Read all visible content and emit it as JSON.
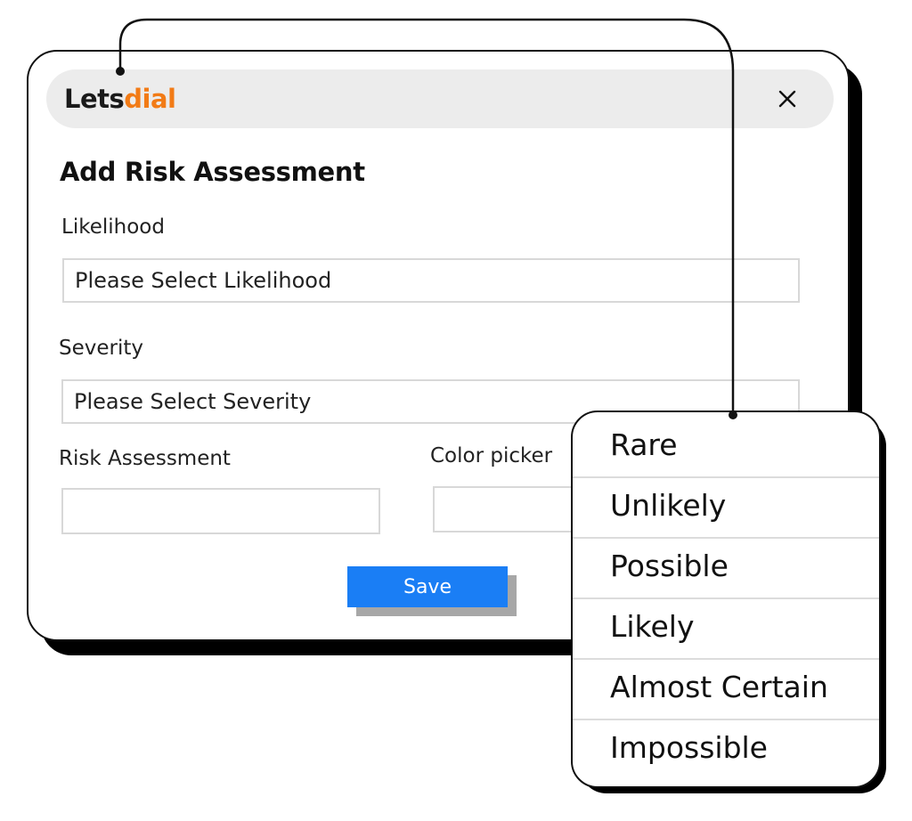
{
  "logo": {
    "part1": "Lets",
    "part2": "dial"
  },
  "dialog": {
    "title": "Add Risk Assessment",
    "close_icon": "close-icon"
  },
  "form": {
    "likelihood_label": "Likelihood",
    "likelihood_placeholder": "Please Select Likelihood",
    "severity_label": "Severity",
    "severity_placeholder": "Please Select Severity",
    "risk_assessment_label": "Risk Assessment",
    "risk_assessment_value": "",
    "color_picker_label": "Color picker",
    "color_picker_value": "",
    "save_label": "Save"
  },
  "dropdown": {
    "options": [
      "Rare",
      "Unlikely",
      "Possible",
      "Likely",
      "Almost Certain",
      "Impossible"
    ]
  },
  "colors": {
    "accent": "#1a7ef5",
    "brand_orange": "#f27b16",
    "header_bg": "#ececec",
    "border": "#111111"
  }
}
